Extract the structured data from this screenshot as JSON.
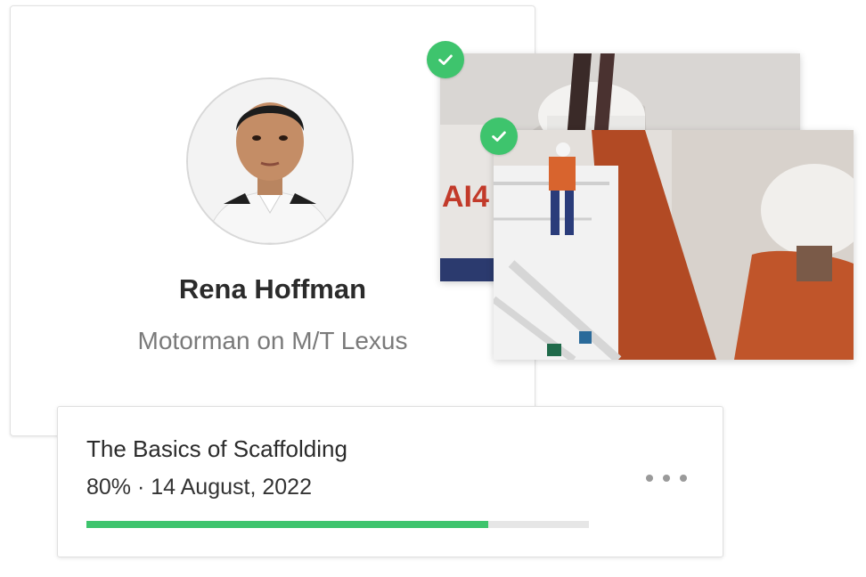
{
  "profile": {
    "name": "Rena Hoffman",
    "role": "Motorman on M/T Lexus",
    "avatar_icon": "person-portrait"
  },
  "photos": [
    {
      "icon": "worker-hardhat-photo",
      "verified": true
    },
    {
      "icon": "ship-deck-worker-photo",
      "verified": true
    }
  ],
  "course": {
    "title": "The Basics of Scaffolding",
    "progress_label": "80% · 14 August, 2022",
    "progress": 0.8,
    "more_icon": "ellipsis-icon"
  },
  "colors": {
    "accent_green": "#3ec46d",
    "track_gray": "#e6e6e6",
    "text_dark": "#2b2b2b",
    "text_muted": "#7a7a7a"
  }
}
